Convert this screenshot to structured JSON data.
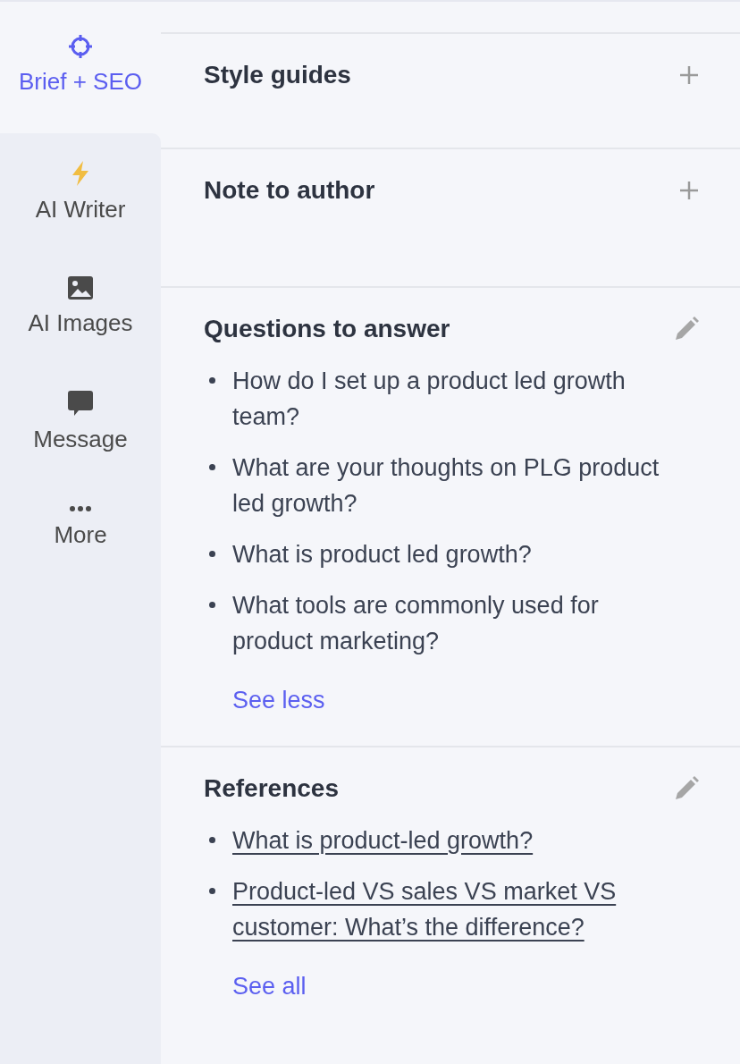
{
  "sidebar": {
    "items": [
      {
        "label": "Brief + SEO",
        "kind": "target",
        "selected": true
      },
      {
        "label": "AI Writer",
        "kind": "bolt",
        "selected": false
      },
      {
        "label": "AI Images",
        "kind": "image",
        "selected": false
      },
      {
        "label": "Message",
        "kind": "message",
        "selected": false
      },
      {
        "label": "More",
        "kind": "more",
        "selected": false
      }
    ]
  },
  "sections": [
    {
      "title": "Style guides",
      "kind": "add"
    },
    {
      "title": "Note to author",
      "kind": "add"
    },
    {
      "title": "Questions to answer",
      "kind": "edit",
      "items": [
        {
          "kind": "text",
          "text": "How do I set up a product led growth team?"
        },
        {
          "kind": "text",
          "text": "What are your thoughts on PLG product led growth?"
        },
        {
          "kind": "text",
          "text": "What is product led growth?"
        },
        {
          "kind": "text",
          "text": "What tools are commonly used for product marketing?"
        }
      ],
      "toggle": "See less"
    },
    {
      "title": "References",
      "kind": "edit",
      "items": [
        {
          "kind": "link",
          "text": "What is product-led growth?"
        },
        {
          "kind": "link",
          "text": "Product-led VS sales VS market VS customer: What’s the difference?"
        }
      ],
      "toggle": "See all"
    }
  ]
}
